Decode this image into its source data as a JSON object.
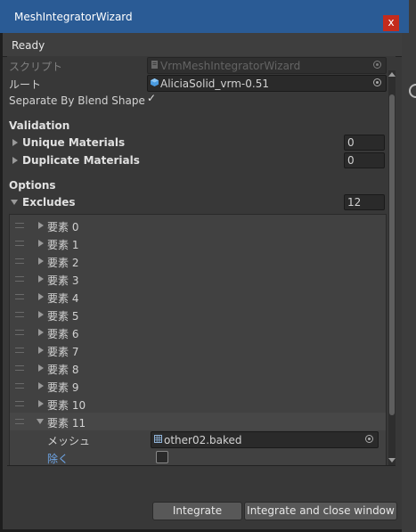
{
  "window": {
    "title": "MeshIntegratorWizard",
    "close_glyph": "x",
    "status": "Ready"
  },
  "fields": {
    "script": {
      "label": "スクリプト",
      "value": "VrmMeshIntegratorWizard"
    },
    "root": {
      "label": "ルート",
      "value": "AliciaSolid_vrm-0.51"
    },
    "separate_by_blend_shape": {
      "label": "Separate By Blend Shape",
      "checked": true,
      "check_glyph": "✓"
    }
  },
  "validation": {
    "header": "Validation",
    "unique_materials": {
      "label": "Unique Materials",
      "value": "0"
    },
    "duplicate_materials": {
      "label": "Duplicate Materials",
      "value": "0"
    }
  },
  "options": {
    "header": "Options",
    "excludes": {
      "label": "Excludes",
      "size": "12",
      "items": [
        {
          "label": "要素 0"
        },
        {
          "label": "要素 1"
        },
        {
          "label": "要素 2"
        },
        {
          "label": "要素 3"
        },
        {
          "label": "要素 4"
        },
        {
          "label": "要素 5"
        },
        {
          "label": "要素 6"
        },
        {
          "label": "要素 7"
        },
        {
          "label": "要素 8"
        },
        {
          "label": "要素 9"
        },
        {
          "label": "要素 10"
        },
        {
          "label": "要素 11"
        }
      ],
      "expanded_item": {
        "mesh_label": "メッシュ",
        "mesh_value": "other02.baked",
        "exclude_label": "除く",
        "exclude_checked": false
      }
    }
  },
  "buttons": {
    "integrate": "Integrate",
    "integrate_close": "Integrate and close window"
  },
  "colors": {
    "title_bar": "#2a5b95",
    "close_button": "#c42b1c",
    "panel": "#383838",
    "accent_label": "#6ea5e6"
  }
}
